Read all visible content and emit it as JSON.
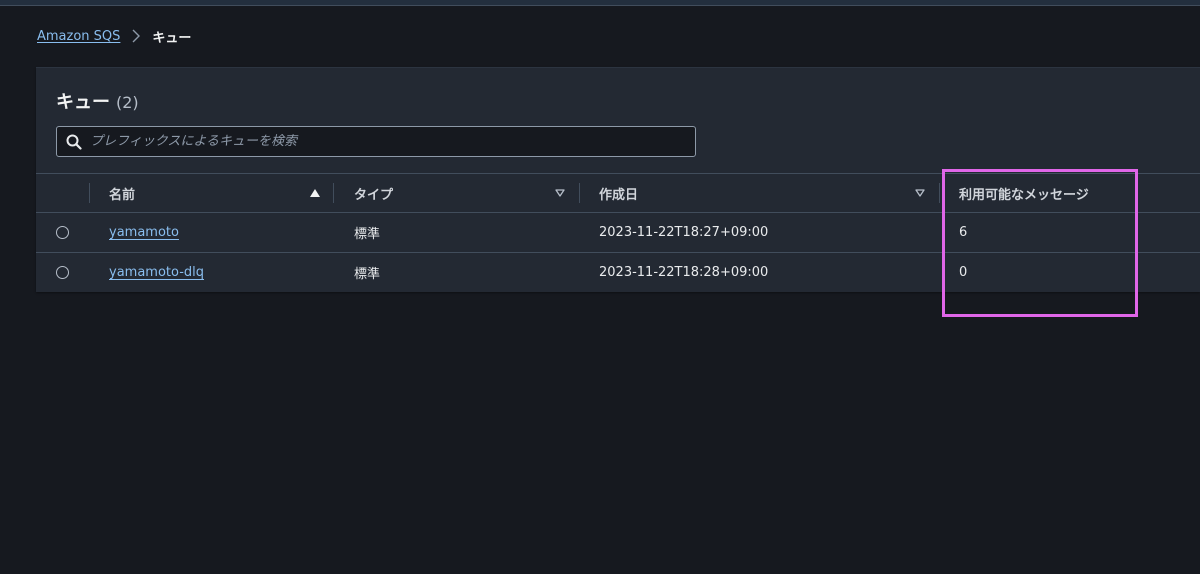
{
  "breadcrumb": {
    "root_label": "Amazon SQS",
    "current_label": "キュー"
  },
  "panel": {
    "title": "キュー",
    "count": "(2)"
  },
  "search": {
    "placeholder": "プレフィックスによるキューを検索",
    "value": ""
  },
  "table": {
    "columns": {
      "name": "名前",
      "type": "タイプ",
      "created": "作成日",
      "available_messages": "利用可能なメッセージ"
    },
    "rows": [
      {
        "name": "yamamoto",
        "type": "標準",
        "created": "2023-11-22T18:27+09:00",
        "available_messages": "6"
      },
      {
        "name": "yamamoto-dlq",
        "type": "標準",
        "created": "2023-11-22T18:28+09:00",
        "available_messages": "0"
      }
    ]
  },
  "colors": {
    "background": "#16191f",
    "panel": "#232933",
    "link": "#89bdee",
    "highlight": "#e066e8"
  },
  "icons": {
    "breadcrumb_separator": "chevron-right-icon",
    "search": "search-icon",
    "sort_ascending": "caret-up-filled-icon",
    "sort_unsorted": "caret-down-outline-icon"
  }
}
